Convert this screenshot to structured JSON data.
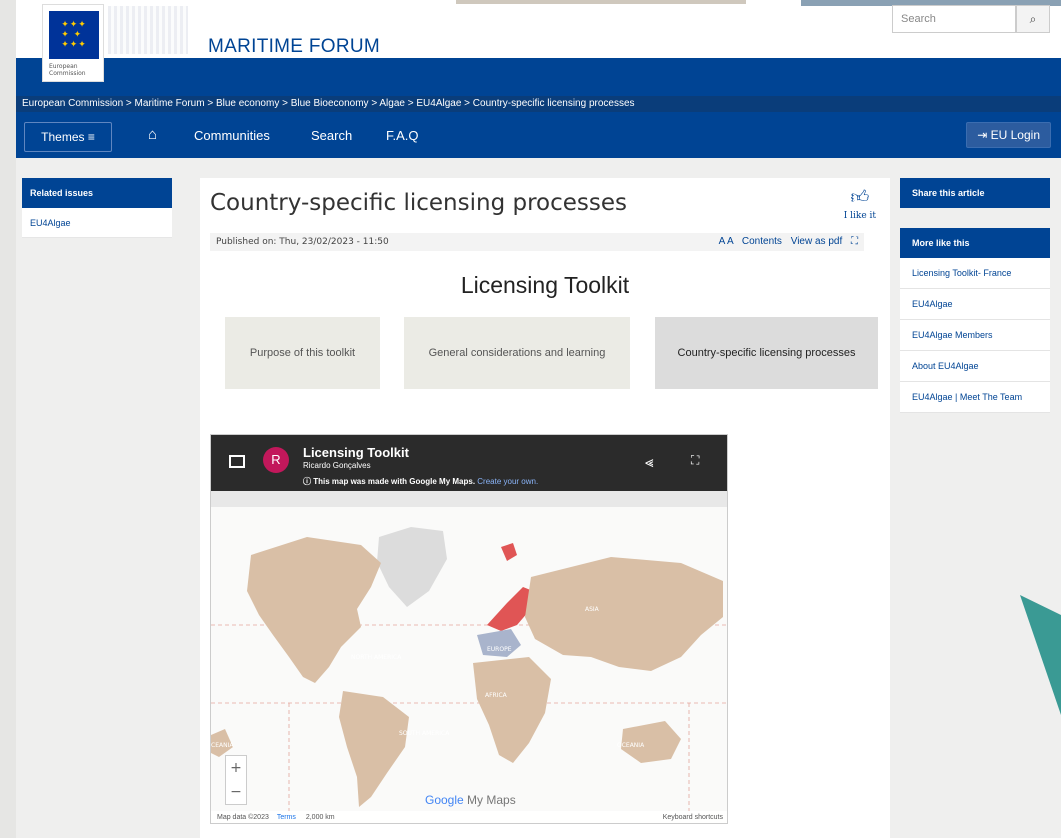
{
  "header": {
    "site_title": "MARITIME FORUM",
    "logo_text_1": "European",
    "logo_text_2": "Commission",
    "search_placeholder": "Search",
    "search_icon": "magnifier-icon"
  },
  "breadcrumb": "European Commission > Maritime Forum > Blue economy > Blue Bioeconomy > Algae > EU4Algae > Country-specific licensing processes",
  "nav": {
    "themes": "Themes ≡",
    "home_icon": "home-icon",
    "links": [
      "Communities",
      "Search",
      "F.A.Q"
    ],
    "login": "⇥ EU Login"
  },
  "left_sidebar": {
    "heading": "Related issues",
    "items": [
      "EU4Algae"
    ]
  },
  "right_sidebar": {
    "share": "Share this article",
    "more_heading": "More like this",
    "items": [
      "Licensing Toolkit- France",
      "EU4Algae",
      "EU4Algae Members",
      "About EU4Algae",
      "EU4Algae | Meet The Team"
    ]
  },
  "article": {
    "title": "Country-specific licensing processes",
    "like_label": "I like it",
    "published": "Published on: Thu, 23/02/2023 - 11:50",
    "font_size": "A A",
    "contents": "Contents",
    "pdf": "View as pdf",
    "toolkit_title": "Licensing Toolkit",
    "cards": [
      "Purpose of this toolkit",
      "General considerations and learning",
      "Country-specific licensing processes"
    ],
    "active_card": 2
  },
  "map": {
    "title": "Licensing Toolkit",
    "avatar_letter": "R",
    "author": "Ricardo Gonçalves",
    "note": "This map was made with Google My Maps.",
    "note_link": "Create your own.",
    "labels": [
      "NORTH AMERICA",
      "SOUTH AMERICA",
      "EUROPE",
      "AFRICA",
      "ASIA",
      "OCEANIA",
      "CEANIA"
    ],
    "google": "Google",
    "my_maps": "My Maps",
    "zoom_in": "+",
    "zoom_out": "−",
    "map_data": "Map data ©2023",
    "terms": "Terms",
    "scale": "2,000 km",
    "keyboard": "Keyboard shortcuts",
    "colors": {
      "land": "#d9bfa6",
      "highlight": "#e05555",
      "ocean": "#fafaf9"
    }
  }
}
